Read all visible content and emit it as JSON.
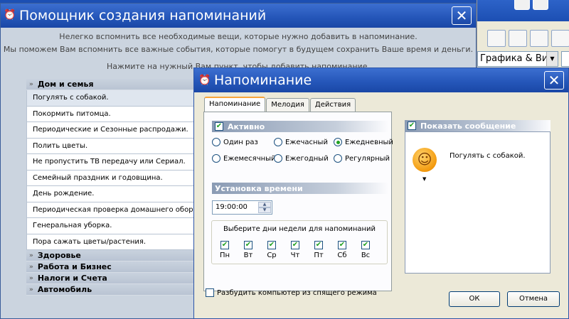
{
  "bg_window": {
    "title_fragment": "... ",
    "combo_text": "Графика & Ви"
  },
  "wizard": {
    "title": "Помощник создания напоминаний",
    "intro_line1": "Нелегко вспомнить все необходимые вещи, которые нужно добавить в напоминание.",
    "intro_line2": "Мы поможем Вам вспомнить все важные события, которые помогут в будущем сохранить Ваше время и деньги.",
    "hint": "Нажмите на нужный Вам пункт, чтобы добавить напоминание.",
    "category_open": "Дом и семья",
    "items": [
      "Погулять с собакой.",
      "Покормить питомца.",
      "Периодические и Сезонные распродажи.",
      "Полить цветы.",
      "Не пропустить ТВ передачу или Сериал.",
      "Семейный праздник и годовщина.",
      "День рождение.",
      "Периодическая проверка домашнего оборудования.",
      "Генеральная уборка.",
      "Пора сажать цветы/растения."
    ],
    "categories_collapsed": [
      "Здоровье",
      "Работа и Бизнес",
      "Налоги и Счета",
      "Автомобиль"
    ]
  },
  "reminder": {
    "title": "Напоминание",
    "tabs": [
      "Напоминание",
      "Мелодия",
      "Действия"
    ],
    "active_label": "Активно",
    "repeat_options": [
      "Один раз",
      "Ежечасный",
      "Ежедневный",
      "Ежемесячный",
      "Ежегодный",
      "Регулярный"
    ],
    "repeat_selected": "Ежедневный",
    "time_section": "Установка времени",
    "time_value": "19:00:00",
    "days_label": "Выберите дни недели для напоминаний",
    "days": [
      "Пн",
      "Вт",
      "Ср",
      "Чт",
      "Пт",
      "Сб",
      "Вс"
    ],
    "days_checked": [
      true,
      true,
      true,
      true,
      true,
      true,
      true
    ],
    "wake_label": "Разбудить компьютер из спящего режима",
    "wake_checked": false,
    "show_message_label": "Показать сообщение",
    "message_text": "Погулять с собакой.",
    "ok": "ОК",
    "cancel": "Отмена"
  }
}
